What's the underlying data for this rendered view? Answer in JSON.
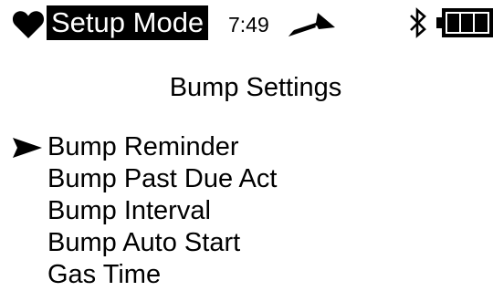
{
  "status_bar": {
    "mode": "Setup Mode",
    "time": "7:49",
    "icons": [
      "heart-icon",
      "trend-icon",
      "bluetooth-icon",
      "battery-icon"
    ],
    "battery_level": 1.0
  },
  "screen": {
    "title": "Bump Settings",
    "menu": [
      {
        "label": "Bump Reminder",
        "selected": true
      },
      {
        "label": "Bump Past Due Act",
        "selected": false
      },
      {
        "label": "Bump Interval",
        "selected": false
      },
      {
        "label": "Bump Auto Start",
        "selected": false
      },
      {
        "label": "Gas Time",
        "selected": false
      }
    ]
  },
  "colors": {
    "foreground": "#000000",
    "background": "#ffffff"
  }
}
